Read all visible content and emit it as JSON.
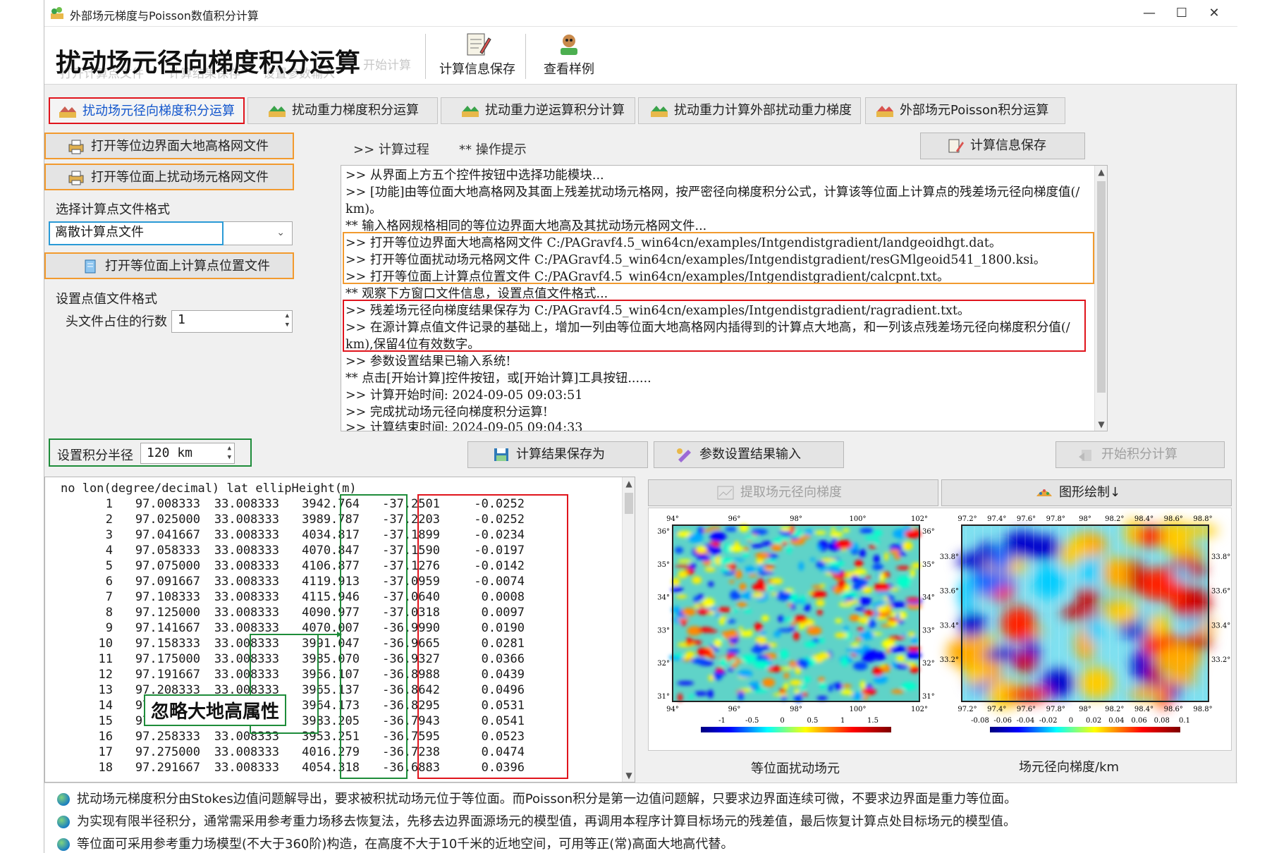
{
  "window": {
    "title": "外部场元梯度与Poisson数值积分计算",
    "controls": [
      "—",
      "☐",
      "✕"
    ]
  },
  "toolbar": {
    "big_title": "扰动场元径向梯度积分运算",
    "ghost_items": [
      "打开计算点文件",
      "计算结果保存",
      "设置参数输入",
      "开始计算"
    ],
    "save_info": "计算信息保存",
    "view_example": "查看样例"
  },
  "tabs": [
    {
      "label": "扰动场元径向梯度积分运算",
      "active": true
    },
    {
      "label": "扰动重力梯度积分运算"
    },
    {
      "label": "扰动重力逆运算积分计算"
    },
    {
      "label": "扰动重力计算外部扰动重力梯度"
    },
    {
      "label": "外部场元Poisson积分运算"
    }
  ],
  "left_panel": {
    "open_boundary_height": "打开等位边界面大地高格网文件",
    "open_disturbance_grid": "打开等位面上扰动场元格网文件",
    "select_format_label": "选择计算点文件格式",
    "format_select_value": "离散计算点文件",
    "open_calc_points": "打开等位面上计算点位置文件",
    "point_value_format_label": "设置点值文件格式",
    "header_rows_label": "头文件占住的行数",
    "header_rows_value": "1"
  },
  "log_panel": {
    "tab_process": ">> 计算过程",
    "tab_tips": "** 操作提示",
    "save_info_button": "计算信息保存",
    "lines": [
      ">> 从界面上方五个控件按钮中选择功能模块...",
      ">> [功能]由等位面大地高格网及其面上残差扰动场元格网，按严密径向梯度积分公式，计算该等位面上计算点的残差场元径向梯度值(/",
      "km)。",
      "  ** 输入格网规格相同的等位边界面大地高及其扰动场元格网文件...",
      ">> 打开等位边界面大地高格网文件 C:/PAGravf4.5_win64cn/examples/Intgendistgradient/landgeoidhgt.dat。",
      ">> 打开等位面扰动场元格网文件 C:/PAGravf4.5_win64cn/examples/Intgendistgradient/resGMlgeoid541_1800.ksi。",
      ">> 打开等位面上计算点位置文件 C:/PAGravf4.5_win64cn/examples/Intgendistgradient/calcpnt.txt。",
      "  ** 观察下方窗口文件信息，设置点值文件格式...",
      ">> 残差场元径向梯度结果保存为 C:/PAGravf4.5_win64cn/examples/Intgendistgradient/ragradient.txt。",
      ">> 在源计算点值文件记录的基础上，增加一列由等位面大地高格网内插得到的计算点大地高，和一列该点残差场元径向梯度积分值(/",
      "km),保留4位有效数字。",
      ">> 参数设置结果已输入系统!",
      "  ** 点击[开始计算]控件按钮，或[开始计算]工具按钮......",
      ">> 计算开始时间: 2024-09-05 09:03:51",
      ">> 完成扰动场元径向梯度积分运算!",
      ">> 计算结束时间: 2024-09-05 09:04:33"
    ]
  },
  "controls_row": {
    "radius_label": "设置积分半径",
    "radius_value": "120  km",
    "save_result_as": "计算结果保存为",
    "param_input": "参数设置结果输入",
    "start_integral": "开始积分计算"
  },
  "data_table": {
    "header": "no lon(degree/decimal) lat ellipHeight(m)",
    "rows": [
      [
        "1",
        "97.008333",
        "33.008333",
        "3942.764",
        "-37.2501",
        "-0.0252"
      ],
      [
        "2",
        "97.025000",
        "33.008333",
        "3989.787",
        "-37.2203",
        "-0.0252"
      ],
      [
        "3",
        "97.041667",
        "33.008333",
        "4034.817",
        "-37.1899",
        "-0.0234"
      ],
      [
        "4",
        "97.058333",
        "33.008333",
        "4070.847",
        "-37.1590",
        "-0.0197"
      ],
      [
        "5",
        "97.075000",
        "33.008333",
        "4106.877",
        "-37.1276",
        "-0.0142"
      ],
      [
        "6",
        "97.091667",
        "33.008333",
        "4119.913",
        "-37.0959",
        "-0.0074"
      ],
      [
        "7",
        "97.108333",
        "33.008333",
        "4115.946",
        "-37.0640",
        "0.0008"
      ],
      [
        "8",
        "97.125000",
        "33.008333",
        "4090.977",
        "-37.0318",
        "0.0097"
      ],
      [
        "9",
        "97.141667",
        "33.008333",
        "4070.007",
        "-36.9990",
        "0.0190"
      ],
      [
        "10",
        "97.158333",
        "33.008333",
        "3991.047",
        "-36.9665",
        "0.0281"
      ],
      [
        "11",
        "97.175000",
        "33.008333",
        "3985.070",
        "-36.9327",
        "0.0366"
      ],
      [
        "12",
        "97.191667",
        "33.008333",
        "3956.107",
        "-36.8988",
        "0.0439"
      ],
      [
        "13",
        "97.208333",
        "33.008333",
        "3965.137",
        "-36.8642",
        "0.0496"
      ],
      [
        "14",
        "97.225000",
        "33.008333",
        "3964.173",
        "-36.8295",
        "0.0531"
      ],
      [
        "15",
        "97.241667",
        "33.008333",
        "3983.205",
        "-36.7943",
        "0.0541"
      ],
      [
        "16",
        "97.258333",
        "33.008333",
        "3953.251",
        "-36.7595",
        "0.0523"
      ],
      [
        "17",
        "97.275000",
        "33.008333",
        "4016.279",
        "-36.7238",
        "0.0474"
      ],
      [
        "18",
        "97.291667",
        "33.008333",
        "4054.318",
        "-36.6883",
        "0.0396"
      ]
    ],
    "annotation": "忽略大地高属性"
  },
  "plots": {
    "extract_button": "提取场元径向梯度",
    "draw_button": "图形绘制↓",
    "left_caption": "等位面扰动场元",
    "right_caption": "场元径向梯度/km",
    "left_x_ticks": [
      "94°",
      "96°",
      "98°",
      "100°",
      "102°"
    ],
    "left_y_ticks": [
      "36°",
      "35°",
      "34°",
      "33°",
      "32°",
      "31°"
    ],
    "left_cbar_ticks": [
      "-1",
      "-0.5",
      "0",
      "0.5",
      "1",
      "1.5"
    ],
    "right_x_ticks": [
      "97.2°",
      "97.4°",
      "97.6°",
      "97.8°",
      "98°",
      "98.2°",
      "98.4°",
      "98.6°",
      "98.8°"
    ],
    "right_y_ticks": [
      "33.8°",
      "33.6°",
      "33.4°",
      "33.2°"
    ],
    "right_cbar_ticks": [
      "-0.08",
      "-0.06",
      "-0.04",
      "-0.02",
      "0",
      "0.02",
      "0.04",
      "0.06",
      "0.08",
      "0.1"
    ]
  },
  "notes": [
    "扰动场元梯度积分由Stokes边值问题解导出，要求被积扰动场元位于等位面。而Poisson积分是第一边值问题解，只要求边界面连续可微，不要求边界面是重力等位面。",
    "为实现有限半径积分，通常需采用参考重力场移去恢复法，先移去边界面源场元的模型值，再调用本程序计算目标场元的残差值，最后恢复计算点处目标场元的模型值。",
    "等位面可采用参考重力场模型(不大于360阶)构造，在高度不大于10千米的近地空间，可用等正(常)高面大地高代替。"
  ]
}
